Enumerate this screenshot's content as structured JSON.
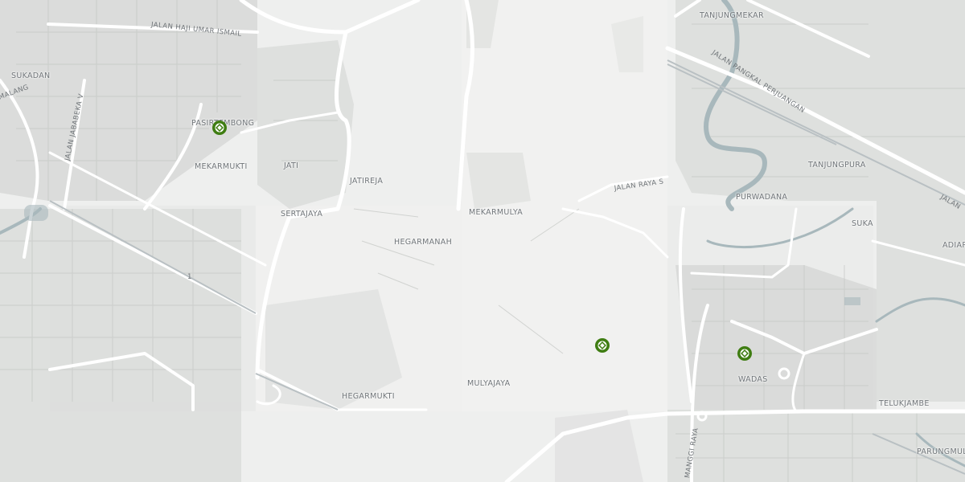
{
  "map": {
    "colors": {
      "background": "#eeefee",
      "tile_alt": "#f1f1f0",
      "urban": "#d6d8d6",
      "road": "#ffffff",
      "river": "#a8b8bc",
      "marker": "#3f7d12"
    },
    "places": [
      {
        "id": "sukadan",
        "name": "SUKADAN"
      },
      {
        "id": "pasirtembong",
        "name": "PASIRTEMBONG"
      },
      {
        "id": "mekarmukti",
        "name": "MEKARMUKTI"
      },
      {
        "id": "jati",
        "name": "JATI"
      },
      {
        "id": "jatireja",
        "name": "JATIREJA"
      },
      {
        "id": "sertajaya",
        "name": "SERTAJAYA"
      },
      {
        "id": "hegarmanah",
        "name": "HEGARMANAH"
      },
      {
        "id": "mekarmulya",
        "name": "MEKARMULYA"
      },
      {
        "id": "hegarmukti",
        "name": "HEGARMUKTI"
      },
      {
        "id": "mulyajaya",
        "name": "MULYAJAYA"
      },
      {
        "id": "tanjungmekar",
        "name": "TANJUNGMEKAR"
      },
      {
        "id": "tanjungpura",
        "name": "TANJUNGPURA"
      },
      {
        "id": "purwadana",
        "name": "PURWADANA"
      },
      {
        "id": "suka",
        "name": "SUKA"
      },
      {
        "id": "adiar",
        "name": "ADIAR"
      },
      {
        "id": "wadas",
        "name": "WADAS"
      },
      {
        "id": "telukjambe",
        "name": "TELUKJAMBE"
      },
      {
        "id": "parungmul",
        "name": "PARUNGMUL"
      },
      {
        "id": "cimalang",
        "name": "CIMALANG"
      }
    ],
    "roads": [
      {
        "id": "jalan-haji-umar-ismail",
        "name": "JALAN HAJI UMAR ISMAIL"
      },
      {
        "id": "jalan-jababeka-v",
        "name": "JALAN JABABEKA V"
      },
      {
        "id": "jalan-pangkal-perjuangan",
        "name": "JALAN PANGKAL PERJUANGAN"
      },
      {
        "id": "jalan-raya",
        "name": "JALAN RAYA S"
      },
      {
        "id": "jalan-right",
        "name": "JALAN"
      },
      {
        "id": "manggi-raya",
        "name": "MANGGI RAYA"
      },
      {
        "id": "marker-one",
        "name": "1"
      }
    ],
    "markers": [
      {
        "id": "marker-pasirtembong"
      },
      {
        "id": "marker-mulyajaya"
      },
      {
        "id": "marker-wadas"
      }
    ]
  }
}
